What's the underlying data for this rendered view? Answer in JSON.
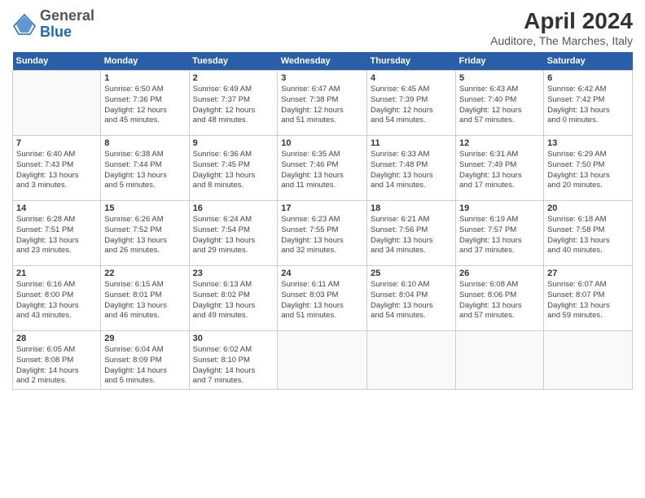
{
  "header": {
    "logo": {
      "general": "General",
      "blue": "Blue"
    },
    "title": "April 2024",
    "subtitle": "Auditore, The Marches, Italy"
  },
  "calendar": {
    "days_of_week": [
      "Sunday",
      "Monday",
      "Tuesday",
      "Wednesday",
      "Thursday",
      "Friday",
      "Saturday"
    ],
    "weeks": [
      [
        {
          "day": "",
          "info": ""
        },
        {
          "day": "1",
          "info": "Sunrise: 6:50 AM\nSunset: 7:36 PM\nDaylight: 12 hours\nand 45 minutes."
        },
        {
          "day": "2",
          "info": "Sunrise: 6:49 AM\nSunset: 7:37 PM\nDaylight: 12 hours\nand 48 minutes."
        },
        {
          "day": "3",
          "info": "Sunrise: 6:47 AM\nSunset: 7:38 PM\nDaylight: 12 hours\nand 51 minutes."
        },
        {
          "day": "4",
          "info": "Sunrise: 6:45 AM\nSunset: 7:39 PM\nDaylight: 12 hours\nand 54 minutes."
        },
        {
          "day": "5",
          "info": "Sunrise: 6:43 AM\nSunset: 7:40 PM\nDaylight: 12 hours\nand 57 minutes."
        },
        {
          "day": "6",
          "info": "Sunrise: 6:42 AM\nSunset: 7:42 PM\nDaylight: 13 hours\nand 0 minutes."
        }
      ],
      [
        {
          "day": "7",
          "info": "Sunrise: 6:40 AM\nSunset: 7:43 PM\nDaylight: 13 hours\nand 3 minutes."
        },
        {
          "day": "8",
          "info": "Sunrise: 6:38 AM\nSunset: 7:44 PM\nDaylight: 13 hours\nand 5 minutes."
        },
        {
          "day": "9",
          "info": "Sunrise: 6:36 AM\nSunset: 7:45 PM\nDaylight: 13 hours\nand 8 minutes."
        },
        {
          "day": "10",
          "info": "Sunrise: 6:35 AM\nSunset: 7:46 PM\nDaylight: 13 hours\nand 11 minutes."
        },
        {
          "day": "11",
          "info": "Sunrise: 6:33 AM\nSunset: 7:48 PM\nDaylight: 13 hours\nand 14 minutes."
        },
        {
          "day": "12",
          "info": "Sunrise: 6:31 AM\nSunset: 7:49 PM\nDaylight: 13 hours\nand 17 minutes."
        },
        {
          "day": "13",
          "info": "Sunrise: 6:29 AM\nSunset: 7:50 PM\nDaylight: 13 hours\nand 20 minutes."
        }
      ],
      [
        {
          "day": "14",
          "info": "Sunrise: 6:28 AM\nSunset: 7:51 PM\nDaylight: 13 hours\nand 23 minutes."
        },
        {
          "day": "15",
          "info": "Sunrise: 6:26 AM\nSunset: 7:52 PM\nDaylight: 13 hours\nand 26 minutes."
        },
        {
          "day": "16",
          "info": "Sunrise: 6:24 AM\nSunset: 7:54 PM\nDaylight: 13 hours\nand 29 minutes."
        },
        {
          "day": "17",
          "info": "Sunrise: 6:23 AM\nSunset: 7:55 PM\nDaylight: 13 hours\nand 32 minutes."
        },
        {
          "day": "18",
          "info": "Sunrise: 6:21 AM\nSunset: 7:56 PM\nDaylight: 13 hours\nand 34 minutes."
        },
        {
          "day": "19",
          "info": "Sunrise: 6:19 AM\nSunset: 7:57 PM\nDaylight: 13 hours\nand 37 minutes."
        },
        {
          "day": "20",
          "info": "Sunrise: 6:18 AM\nSunset: 7:58 PM\nDaylight: 13 hours\nand 40 minutes."
        }
      ],
      [
        {
          "day": "21",
          "info": "Sunrise: 6:16 AM\nSunset: 8:00 PM\nDaylight: 13 hours\nand 43 minutes."
        },
        {
          "day": "22",
          "info": "Sunrise: 6:15 AM\nSunset: 8:01 PM\nDaylight: 13 hours\nand 46 minutes."
        },
        {
          "day": "23",
          "info": "Sunrise: 6:13 AM\nSunset: 8:02 PM\nDaylight: 13 hours\nand 49 minutes."
        },
        {
          "day": "24",
          "info": "Sunrise: 6:11 AM\nSunset: 8:03 PM\nDaylight: 13 hours\nand 51 minutes."
        },
        {
          "day": "25",
          "info": "Sunrise: 6:10 AM\nSunset: 8:04 PM\nDaylight: 13 hours\nand 54 minutes."
        },
        {
          "day": "26",
          "info": "Sunrise: 6:08 AM\nSunset: 8:06 PM\nDaylight: 13 hours\nand 57 minutes."
        },
        {
          "day": "27",
          "info": "Sunrise: 6:07 AM\nSunset: 8:07 PM\nDaylight: 13 hours\nand 59 minutes."
        }
      ],
      [
        {
          "day": "28",
          "info": "Sunrise: 6:05 AM\nSunset: 8:08 PM\nDaylight: 14 hours\nand 2 minutes."
        },
        {
          "day": "29",
          "info": "Sunrise: 6:04 AM\nSunset: 8:09 PM\nDaylight: 14 hours\nand 5 minutes."
        },
        {
          "day": "30",
          "info": "Sunrise: 6:02 AM\nSunset: 8:10 PM\nDaylight: 14 hours\nand 7 minutes."
        },
        {
          "day": "",
          "info": ""
        },
        {
          "day": "",
          "info": ""
        },
        {
          "day": "",
          "info": ""
        },
        {
          "day": "",
          "info": ""
        }
      ]
    ]
  }
}
